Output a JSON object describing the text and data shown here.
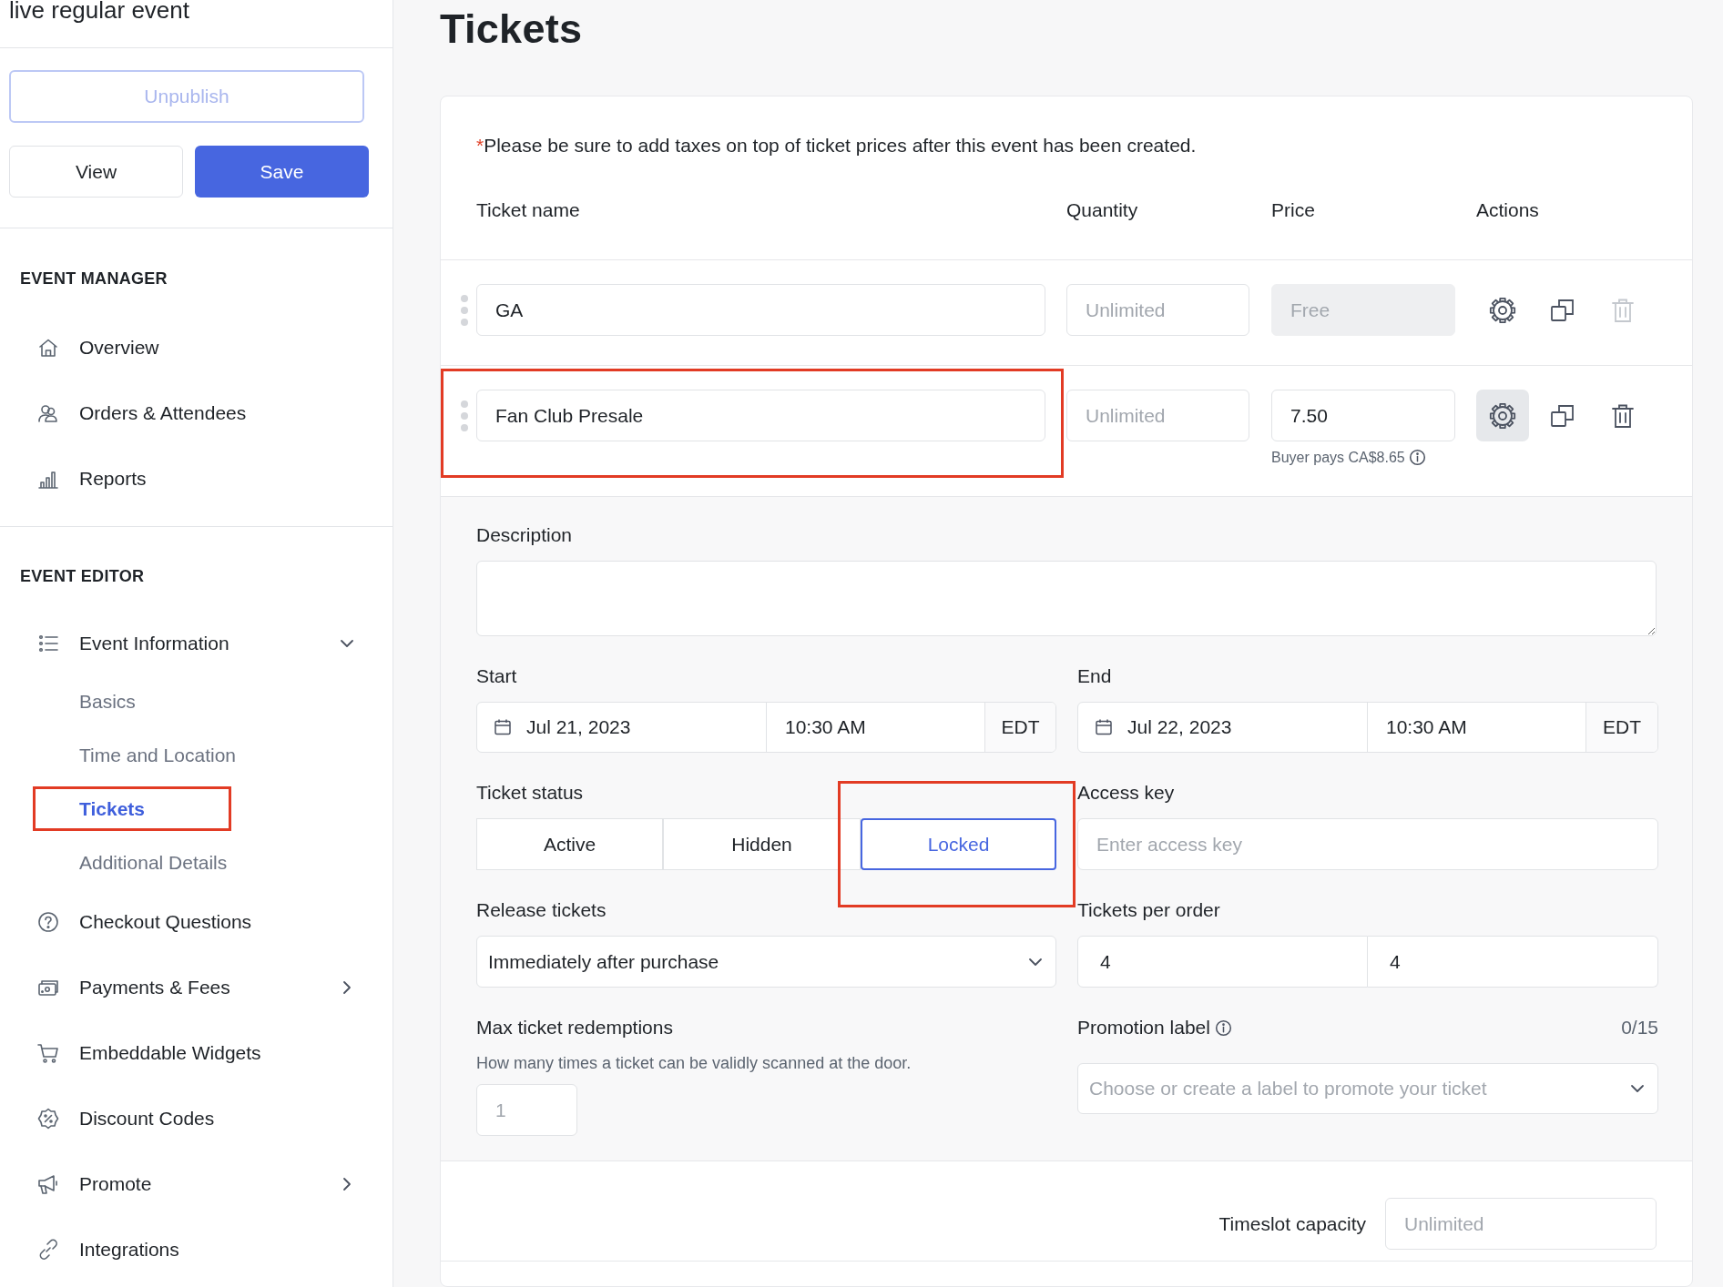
{
  "sidebar": {
    "event_title": "live regular event",
    "buttons": [
      {
        "label": "Unpublish",
        "kind": "outline"
      },
      {
        "label": "View",
        "kind": "default"
      },
      {
        "label": "Save",
        "kind": "primary"
      }
    ],
    "sections": [
      {
        "heading": "EVENT MANAGER",
        "items": [
          {
            "label": "Overview",
            "selected": false
          },
          {
            "label": "Orders & Attendees",
            "selected": false
          },
          {
            "label": "Reports",
            "selected": false
          }
        ]
      },
      {
        "heading": "EVENT EDITOR",
        "items": [
          {
            "label": "Event Information",
            "selected": false,
            "expanded": true,
            "children": [
              {
                "label": "Basics",
                "selected": false,
                "highlighted": false
              },
              {
                "label": "Time and Location",
                "selected": false,
                "highlighted": false
              },
              {
                "label": "Tickets",
                "selected": true,
                "highlighted": true
              },
              {
                "label": "Additional Details",
                "selected": false,
                "highlighted": false
              }
            ]
          },
          {
            "label": "Checkout Questions",
            "selected": false
          },
          {
            "label": "Payments & Fees",
            "selected": false,
            "expanded": false
          },
          {
            "label": "Embeddable Widgets",
            "selected": false
          },
          {
            "label": "Discount Codes",
            "selected": false
          },
          {
            "label": "Promote",
            "selected": false,
            "expanded": false
          },
          {
            "label": "Integrations",
            "selected": false
          }
        ]
      }
    ]
  },
  "page_title": "Tickets",
  "tickets": {
    "required_mark": "*",
    "note": "Please be sure to add taxes on top of ticket prices after this event has been created.",
    "columns": [
      "Ticket name",
      "Quantity",
      "Price",
      "Actions"
    ],
    "rows": [
      {
        "name": {
          "value": "GA"
        },
        "quantity": {
          "placeholder": "Unlimited"
        },
        "price": {
          "placeholder": "Free",
          "disabled": true
        },
        "settings_active": false,
        "delete_disabled": true,
        "highlighted": false
      },
      {
        "name": {
          "value": "Fan Club Presale"
        },
        "quantity": {
          "placeholder": "Unlimited"
        },
        "price": {
          "value": "7.50",
          "disabled": false,
          "hint": "Buyer pays CA$8.65"
        },
        "settings_active": true,
        "delete_disabled": false,
        "highlighted": true
      }
    ],
    "details": {
      "description": {
        "label": "Description"
      },
      "start": {
        "label": "Start",
        "date": "Jul 21, 2023",
        "time": "10:30 AM",
        "zone": "EDT"
      },
      "end": {
        "label": "End",
        "date": "Jul 22, 2023",
        "time": "10:30 AM",
        "zone": "EDT"
      },
      "ticket_status": {
        "label": "Ticket status",
        "options": [
          {
            "label": "Active",
            "selected": false,
            "highlighted": false
          },
          {
            "label": "Hidden",
            "selected": false,
            "highlighted": false
          },
          {
            "label": "Locked",
            "selected": true,
            "highlighted": true
          }
        ]
      },
      "access_key": {
        "label": "Access key",
        "placeholder": "Enter access key"
      },
      "release_tickets": {
        "label": "Release tickets",
        "value": "Immediately after purchase"
      },
      "tickets_per_order": {
        "label": "Tickets per order",
        "min": "4",
        "max": "4"
      },
      "max_redemptions": {
        "label": "Max ticket redemptions",
        "help": "How many times a ticket can be validly scanned at the door.",
        "placeholder": "1"
      },
      "promotion_label": {
        "label": "Promotion label",
        "counter": "0/15",
        "placeholder": "Choose or create a label to promote your ticket"
      }
    },
    "timeslot_capacity": {
      "label": "Timeslot capacity",
      "placeholder": "Unlimited"
    }
  }
}
